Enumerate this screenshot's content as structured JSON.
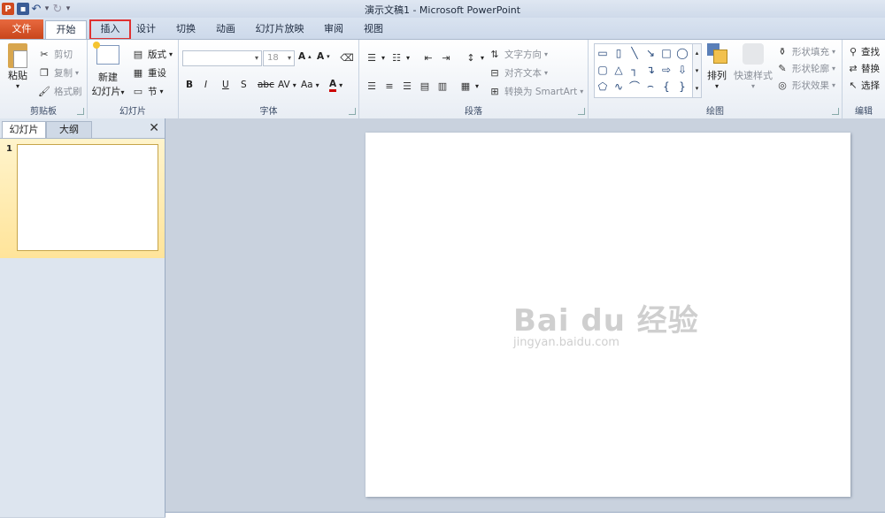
{
  "window": {
    "title": "演示文稿1 - Microsoft PowerPoint"
  },
  "qat": {
    "ppt_icon": "P"
  },
  "tabs": [
    {
      "label": "文件"
    },
    {
      "label": "开始"
    },
    {
      "label": "插入"
    },
    {
      "label": "设计"
    },
    {
      "label": "切换"
    },
    {
      "label": "动画"
    },
    {
      "label": "幻灯片放映"
    },
    {
      "label": "审阅"
    },
    {
      "label": "视图"
    }
  ],
  "ribbon": {
    "clipboard": {
      "label": "剪贴板",
      "paste": "粘贴",
      "cut": "剪切",
      "copy": "复制",
      "format_painter": "格式刷"
    },
    "slides": {
      "label": "幻灯片",
      "new_slide_1": "新建",
      "new_slide_2": "幻灯片",
      "layout": "版式",
      "reset": "重设",
      "section": "节"
    },
    "font": {
      "label": "字体",
      "font_size": "18",
      "bold": "B",
      "italic": "I",
      "underline": "U",
      "strike": "S",
      "abc": "abc",
      "av": "AV",
      "aa": "Aa",
      "grow": "A",
      "shrink": "A",
      "color": "A"
    },
    "paragraph": {
      "label": "段落",
      "text_direction": "文字方向",
      "align_text": "对齐文本",
      "smartart": "转换为 SmartArt"
    },
    "drawing": {
      "label": "绘图",
      "arrange": "排列",
      "quick_styles": "快速样式",
      "shape_fill": "形状填充",
      "shape_outline": "形状轮廓",
      "shape_effects": "形状效果"
    },
    "editing": {
      "label": "编辑",
      "find": "查找",
      "replace": "替换",
      "select": "选择"
    }
  },
  "panel": {
    "tab_slides": "幻灯片",
    "tab_outline": "大纲",
    "slide_number": "1"
  },
  "watermark": {
    "logo": "Bai du 经验",
    "url": "jingyan.baidu.com"
  }
}
